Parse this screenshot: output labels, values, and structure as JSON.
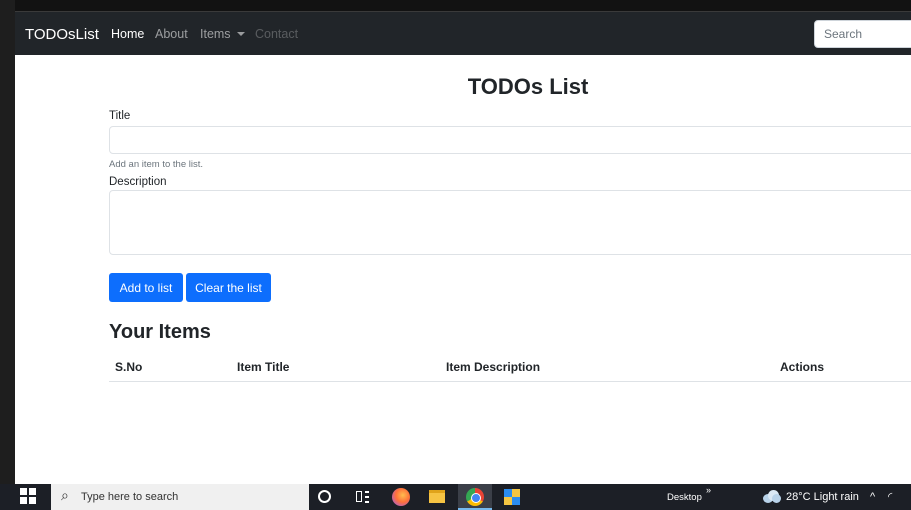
{
  "navbar": {
    "brand": "TODOsList",
    "links": [
      {
        "label": "Home",
        "state": "active"
      },
      {
        "label": "About",
        "state": "normal"
      },
      {
        "label": "Items",
        "state": "dropdown"
      },
      {
        "label": "Contact",
        "state": "disabled"
      }
    ],
    "search_placeholder": "Search"
  },
  "form": {
    "heading": "TODOs List",
    "title_label": "Title",
    "title_value": "",
    "title_help": "Add an item to the list.",
    "description_label": "Description",
    "description_value": "",
    "add_button": "Add to list",
    "clear_button": "Clear the list"
  },
  "items": {
    "heading": "Your Items",
    "columns": [
      "S.No",
      "Item Title",
      "Item Description",
      "Actions"
    ],
    "rows": []
  },
  "taskbar": {
    "search_placeholder": "Type here to search",
    "desktop_label": "Desktop",
    "desktop_chevron": "»",
    "weather": "28°C  Light rain",
    "tray_chevron": "^",
    "active_app": "chrome"
  },
  "colors": {
    "navbar_bg": "#212529",
    "primary_button": "#0d6efd",
    "taskbar_bg": "#1c1f26"
  }
}
